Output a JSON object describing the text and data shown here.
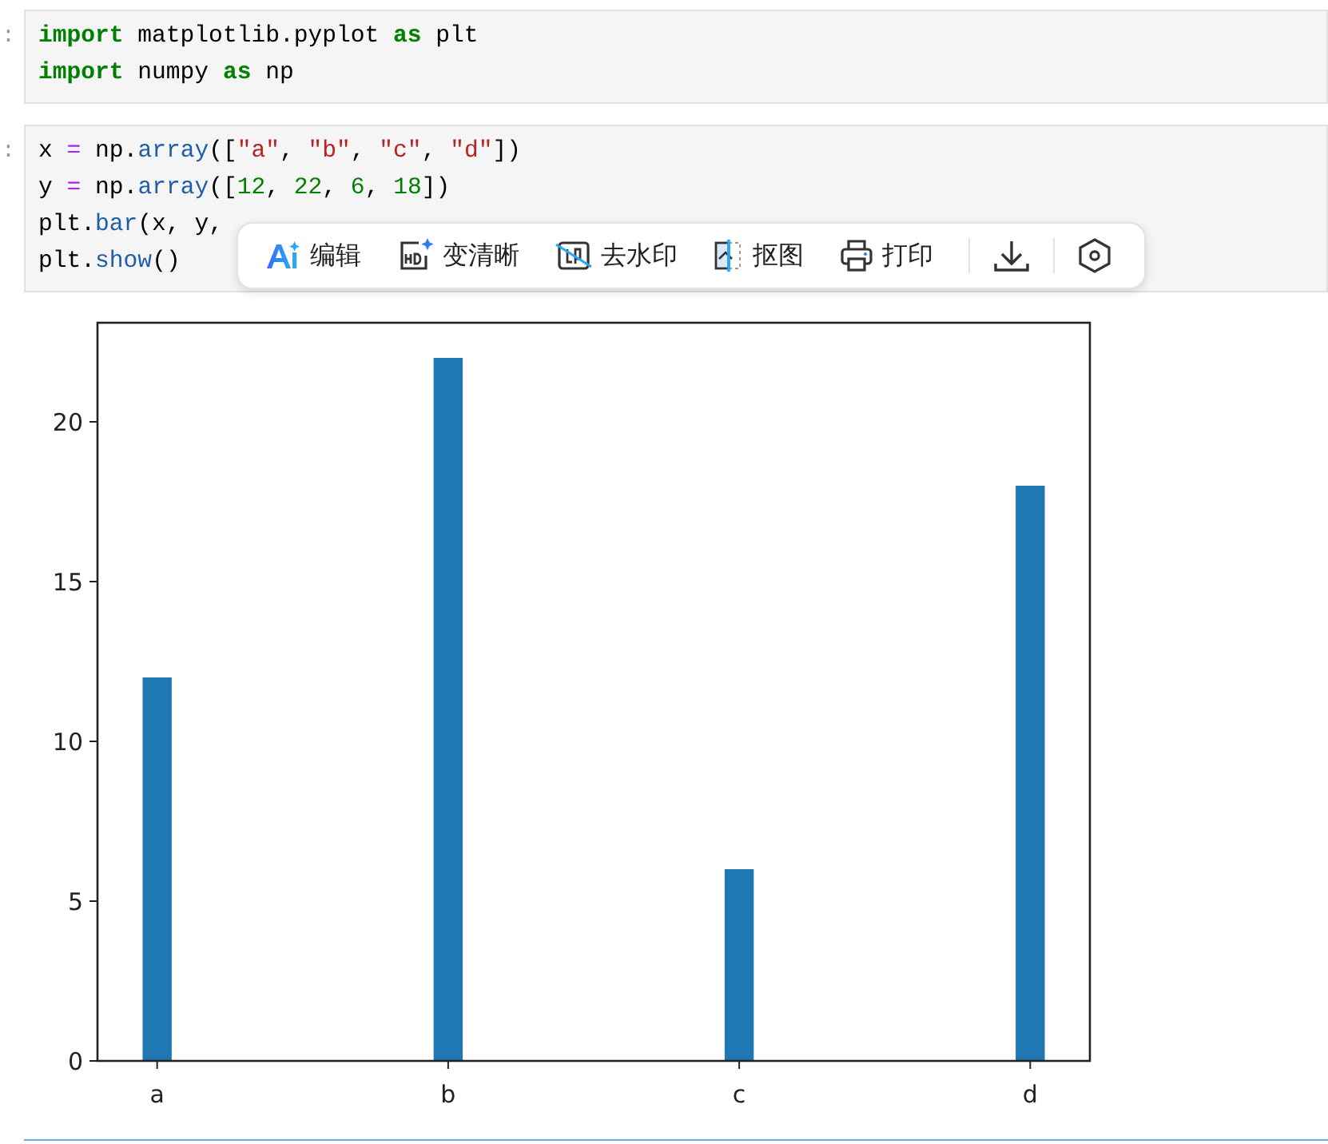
{
  "cells": [
    {
      "prompt": ":",
      "lines": [
        [
          {
            "kind": "kw",
            "text": "import"
          },
          {
            "kind": "plain",
            "text": " matplotlib.pyplot "
          },
          {
            "kind": "kw",
            "text": "as"
          },
          {
            "kind": "plain",
            "text": " plt"
          }
        ],
        [
          {
            "kind": "kw",
            "text": "import"
          },
          {
            "kind": "plain",
            "text": " numpy "
          },
          {
            "kind": "kw",
            "text": "as"
          },
          {
            "kind": "plain",
            "text": " np"
          }
        ]
      ]
    },
    {
      "prompt": ":",
      "lines": [
        [
          {
            "kind": "plain",
            "text": "x "
          },
          {
            "kind": "op",
            "text": "="
          },
          {
            "kind": "plain",
            "text": " np."
          },
          {
            "kind": "attr",
            "text": "array"
          },
          {
            "kind": "plain",
            "text": "(["
          },
          {
            "kind": "str",
            "text": "\"a\""
          },
          {
            "kind": "plain",
            "text": ", "
          },
          {
            "kind": "str",
            "text": "\"b\""
          },
          {
            "kind": "plain",
            "text": ", "
          },
          {
            "kind": "str",
            "text": "\"c\""
          },
          {
            "kind": "plain",
            "text": ", "
          },
          {
            "kind": "str",
            "text": "\"d\""
          },
          {
            "kind": "plain",
            "text": "])"
          }
        ],
        [
          {
            "kind": "plain",
            "text": "y "
          },
          {
            "kind": "op",
            "text": "="
          },
          {
            "kind": "plain",
            "text": " np."
          },
          {
            "kind": "attr",
            "text": "array"
          },
          {
            "kind": "plain",
            "text": "(["
          },
          {
            "kind": "num",
            "text": "12"
          },
          {
            "kind": "plain",
            "text": ", "
          },
          {
            "kind": "num",
            "text": "22"
          },
          {
            "kind": "plain",
            "text": ", "
          },
          {
            "kind": "num",
            "text": "6"
          },
          {
            "kind": "plain",
            "text": ", "
          },
          {
            "kind": "num",
            "text": "18"
          },
          {
            "kind": "plain",
            "text": "])"
          }
        ],
        [
          {
            "kind": "plain",
            "text": "plt."
          },
          {
            "kind": "attr",
            "text": "bar"
          },
          {
            "kind": "plain",
            "text": "(x, y,"
          }
        ],
        [
          {
            "kind": "plain",
            "text": "plt."
          },
          {
            "kind": "attr",
            "text": "show"
          },
          {
            "kind": "plain",
            "text": "()"
          }
        ]
      ]
    }
  ],
  "toolbar": {
    "items": [
      {
        "kind": "ai",
        "label": "编辑"
      },
      {
        "kind": "hd",
        "label": "变清晰"
      },
      {
        "kind": "watermark",
        "label": "去水印"
      },
      {
        "kind": "cutout",
        "label": "抠图"
      },
      {
        "kind": "print",
        "label": "打印"
      },
      {
        "kind": "download"
      },
      {
        "kind": "settings"
      }
    ]
  },
  "output": {
    "chart_data": {
      "type": "bar",
      "categories": [
        "a",
        "b",
        "c",
        "d"
      ],
      "values": [
        12,
        22,
        6,
        18
      ],
      "color": "#1f77b4",
      "ylim": [
        0,
        23.1
      ],
      "yticks": [
        0,
        5,
        10,
        15,
        20
      ]
    }
  }
}
